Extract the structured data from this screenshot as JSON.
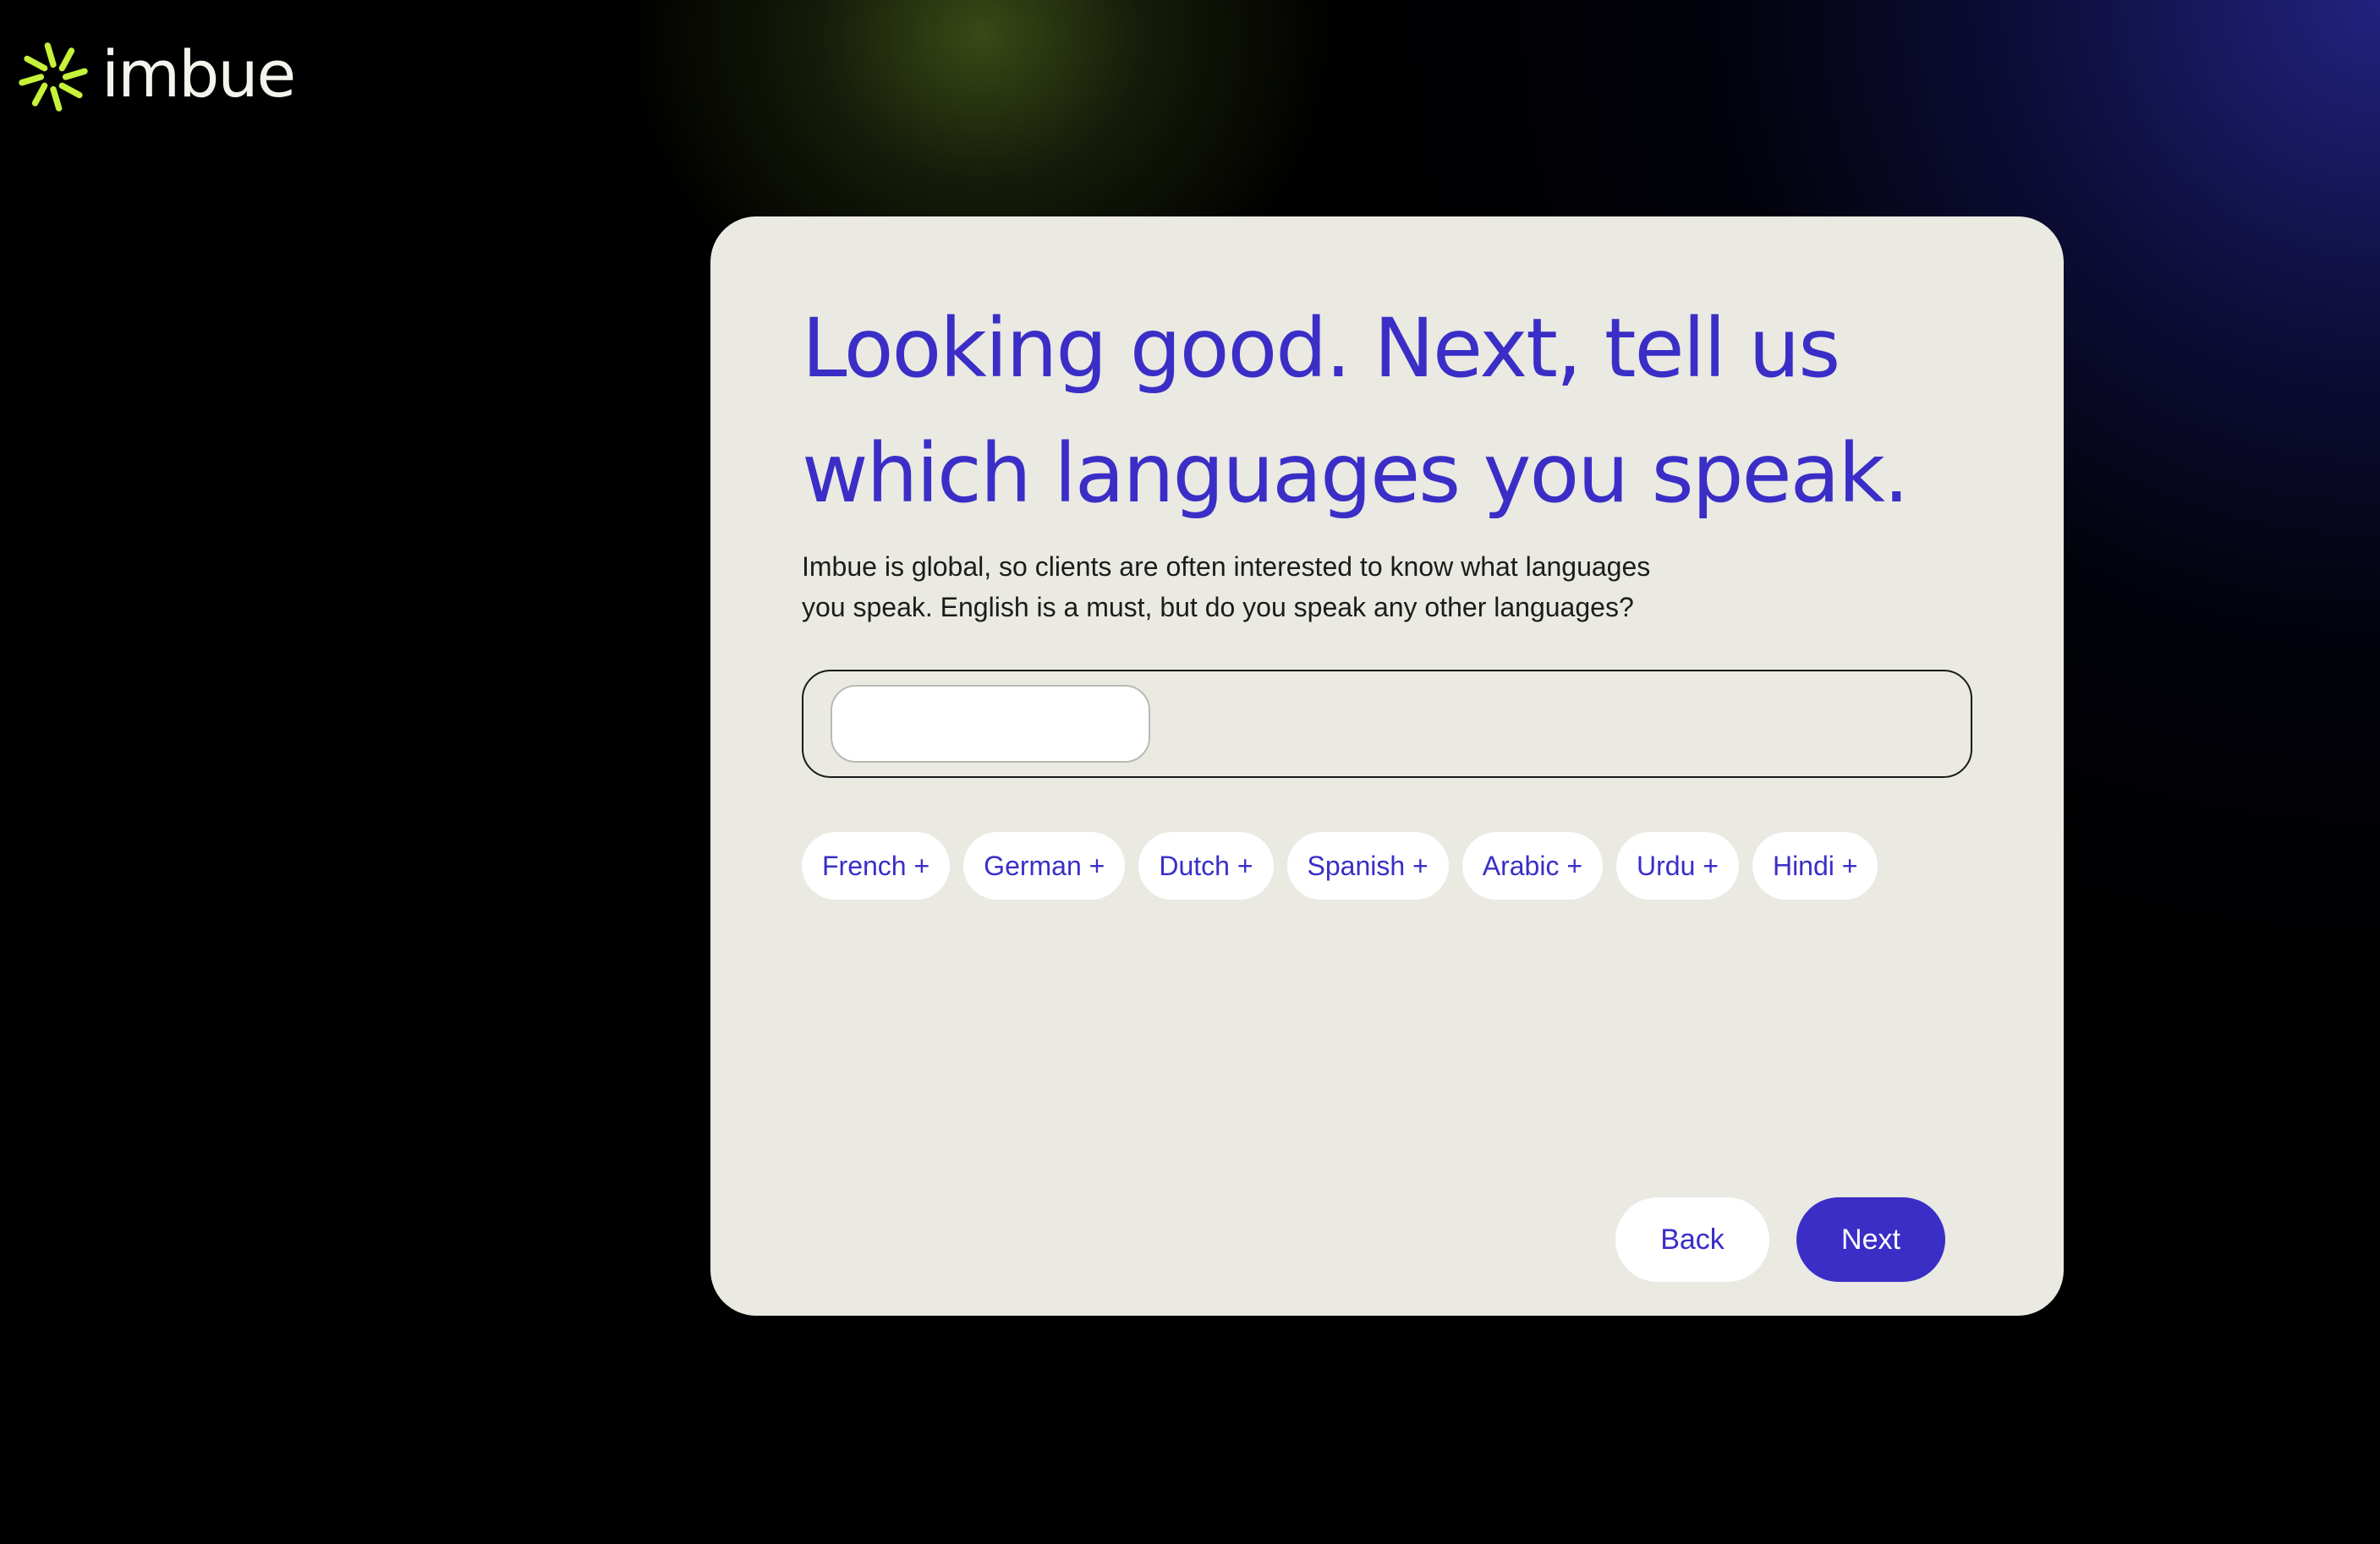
{
  "brand": {
    "name": "imbue",
    "icon": "sunburst-logo-icon",
    "accent_color": "#c6f23a"
  },
  "card": {
    "title": "Looking good. Next, tell us which languages you speak.",
    "description": "Imbue is global, so clients are often interested to know what languages you speak. English is a must, but do you speak any other languages?",
    "language_input": {
      "value": "",
      "placeholder": ""
    },
    "suggestions": [
      "French +",
      "German +",
      "Dutch +",
      "Spanish +",
      "Arabic +",
      "Urdu +",
      "Hindi +"
    ],
    "back_label": "Back",
    "next_label": "Next"
  },
  "colors": {
    "primary": "#3a2ec7",
    "card_background": "#eae9e2",
    "page_background": "#000000"
  }
}
